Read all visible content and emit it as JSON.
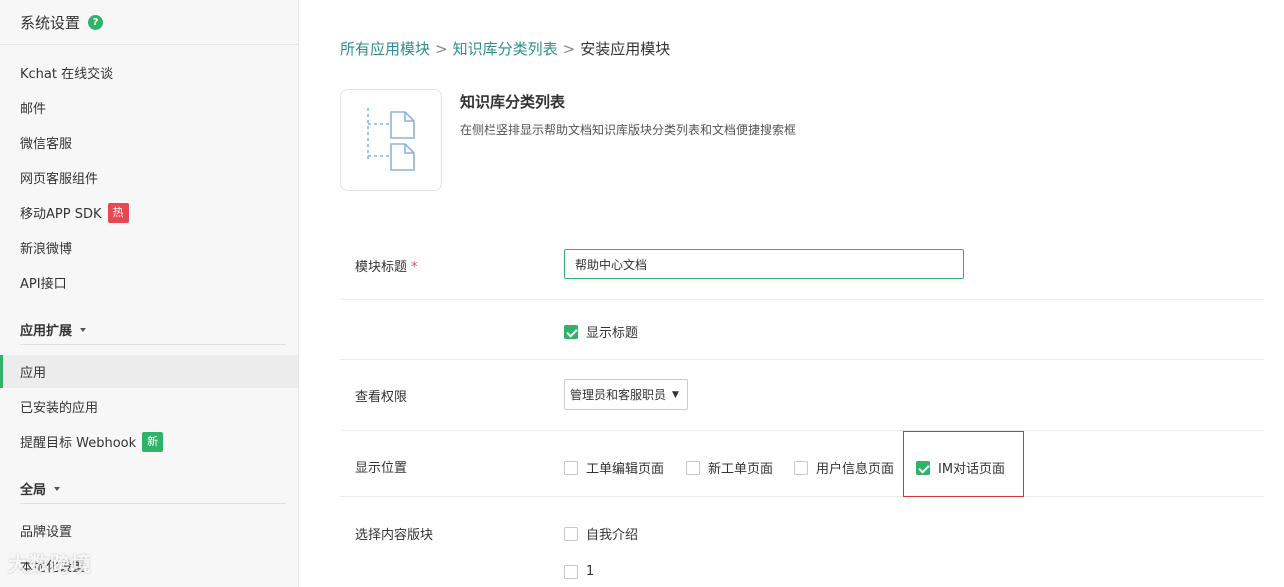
{
  "sidebar": {
    "header_title": "系统设置",
    "help_icon": "?",
    "items": [
      {
        "label": "Kchat 在线交谈"
      },
      {
        "label": "邮件"
      },
      {
        "label": "微信客服"
      },
      {
        "label": "网页客服组件"
      },
      {
        "label": "移动APP SDK",
        "badge": "热"
      },
      {
        "label": "新浪微博"
      },
      {
        "label": "API接口"
      }
    ],
    "group_extend": "应用扩展",
    "extend_items": [
      {
        "label": "应用"
      },
      {
        "label": "已安装的应用"
      },
      {
        "label": "提醒目标 Webhook",
        "badge": "新"
      }
    ],
    "group_global": "全局",
    "global_items": [
      {
        "label": "品牌设置"
      },
      {
        "label": "本地化设置"
      }
    ]
  },
  "breadcrumb": {
    "level1": "所有应用模块",
    "level2": "知识库分类列表",
    "current": "安装应用模块",
    "separator": ">"
  },
  "module": {
    "title": "知识库分类列表",
    "description": "在侧栏竖排显示帮助文档知识库版块分类列表和文档便捷搜索框",
    "icon": "document-tree-icon"
  },
  "form": {
    "title_label": "模块标题",
    "required_mark": "*",
    "title_value": "帮助中心文档",
    "show_title_label": "显示标题",
    "show_title_checked": true,
    "permission_label": "查看权限",
    "permission_value": "管理员和客服职员",
    "position_label": "显示位置",
    "positions": [
      {
        "label": "工单编辑页面",
        "checked": false
      },
      {
        "label": "新工单页面",
        "checked": false
      },
      {
        "label": "用户信息页面",
        "checked": false
      },
      {
        "label": "IM对话页面",
        "checked": true
      }
    ],
    "content_label": "选择内容版块",
    "content_options": [
      {
        "label": "自我介绍",
        "checked": false
      },
      {
        "label": "1",
        "checked": false
      }
    ]
  },
  "colors": {
    "accent": "#2fb36b",
    "link": "#2c8e90",
    "highlight_border": "#d9312f",
    "hot_badge": "#e8484e"
  },
  "watermark": "大数跨境"
}
